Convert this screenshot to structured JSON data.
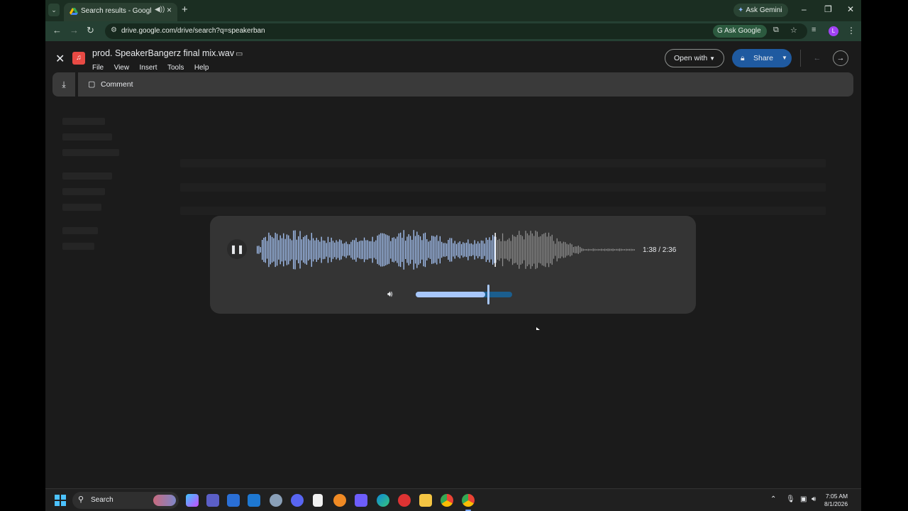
{
  "browser": {
    "tab": {
      "title": "Search results - Google Dri",
      "audio_indicator": "speaker-icon"
    },
    "new_tab_icon": "plus-icon",
    "ask_gemini": "Ask Gemini",
    "url": "drive.google.com/drive/search?q=speakerban",
    "ask_google": "Ask Google",
    "profile_initial": "L"
  },
  "drive_preview": {
    "file_name": "prod. SpeakerBangerz final mix.wav",
    "menu": [
      "File",
      "View",
      "Insert",
      "Tools",
      "Help"
    ],
    "open_with_label": "Open with",
    "share_label": "Share",
    "comment_label": "Comment"
  },
  "audio_player": {
    "time": "1:38 / 2:36",
    "playback_progress": 0.628,
    "volume_level": 0.75,
    "state": "playing"
  },
  "taskbar": {
    "search_label": "Search",
    "time": "7:05 AM",
    "date": "8/1/2026"
  },
  "colors": {
    "chrome_frame": "#1b2e22",
    "share_button": "#1f5aa0",
    "waveform_played": "#a8c7fa",
    "waveform_remaining": "#8e8e8e",
    "volume_fill": "#a8c7fa",
    "volume_track": "#1b5e8e"
  }
}
